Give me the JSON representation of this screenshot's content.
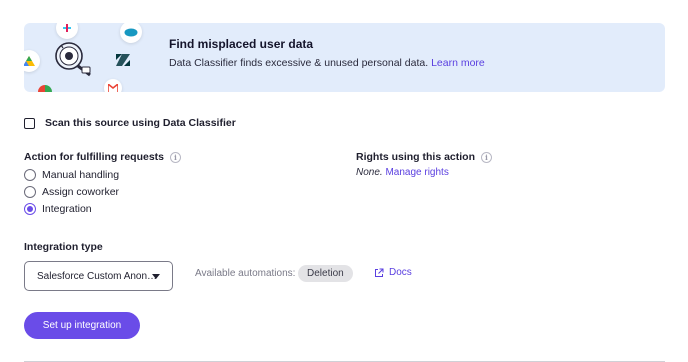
{
  "banner": {
    "title": "Find misplaced user data",
    "description": "Data Classifier finds excessive & unused personal data.",
    "link": "Learn more",
    "icons": [
      "slack-icon",
      "salesforce-icon",
      "google-drive-icon",
      "zendesk-icon",
      "gmail-icon",
      "magnifier-icon"
    ]
  },
  "scan": {
    "label": "Scan this source using Data Classifier",
    "checked": false
  },
  "action": {
    "label": "Action for fulfilling requests",
    "options": [
      "Manual handling",
      "Assign coworker",
      "Integration"
    ],
    "selected": "Integration"
  },
  "rights": {
    "label": "Rights using this action",
    "none": "None.",
    "link": "Manage rights"
  },
  "integration": {
    "label": "Integration type",
    "selected": "Salesforce Custom Anon…",
    "available_label": "Available automations:",
    "badge": "Deletion",
    "docs": "Docs"
  },
  "setup_button": "Set up integration",
  "colors": {
    "accent": "#6a4ce8",
    "banner_bg": "#e2ecfb",
    "link": "#5a3fe0"
  }
}
